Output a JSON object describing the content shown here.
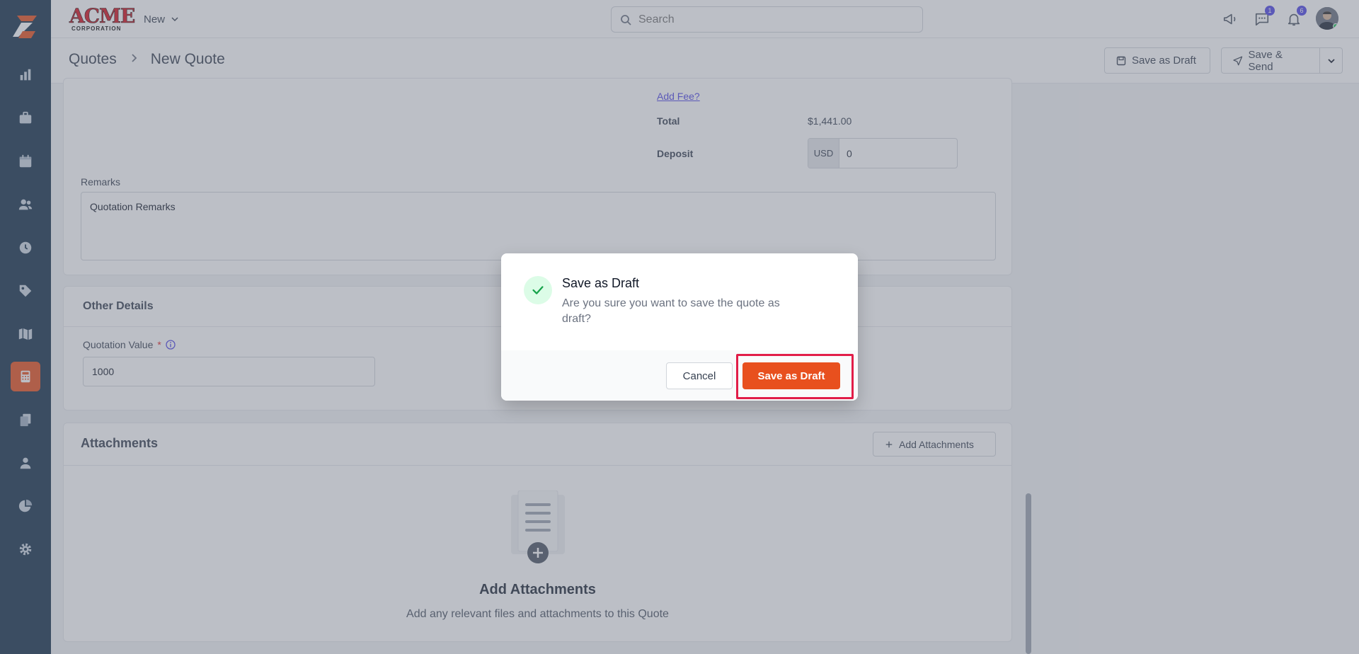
{
  "brand": {
    "name": "ACME",
    "sub": "CORPORATION"
  },
  "topbar": {
    "new_label": "New",
    "search_placeholder": "Search",
    "messages_badge": "1",
    "notifications_badge": "6"
  },
  "breadcrumb": {
    "parent": "Quotes",
    "current": "New Quote"
  },
  "header_buttons": {
    "save_draft": "Save as Draft",
    "save_send": "Save & Send"
  },
  "totals": {
    "add_fee_link": "Add Fee?",
    "total_label": "Total",
    "total_value": "$1,441.00",
    "deposit_label": "Deposit",
    "currency": "USD",
    "deposit_value": "0"
  },
  "remarks": {
    "label": "Remarks",
    "value": "Quotation Remarks"
  },
  "other_details": {
    "title": "Other Details",
    "quotation_value_label": "Quotation Value",
    "required_mark": "*",
    "quotation_value": "1000"
  },
  "attachments": {
    "title": "Attachments",
    "add_button": "Add Attachments",
    "empty_title": "Add Attachments",
    "empty_text": "Add any relevant files and attachments to this Quote"
  },
  "modal": {
    "title": "Save as Draft",
    "message": "Are you sure you want to save the quote as draft?",
    "cancel": "Cancel",
    "confirm": "Save as Draft"
  },
  "colors": {
    "accent": "#e8501e",
    "sidebar": "#14304a",
    "success": "#16a34a",
    "highlight": "#e11d48"
  }
}
